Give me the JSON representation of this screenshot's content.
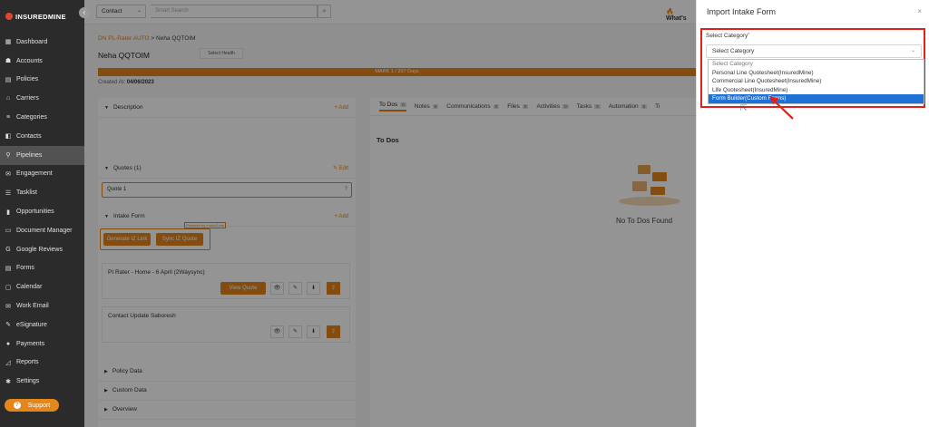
{
  "brand": {
    "name": "INSUREDMINE"
  },
  "sidebar": {
    "collapse_icon": "‹",
    "items": [
      {
        "label": "Dashboard",
        "icon": "▦"
      },
      {
        "label": "Accounts",
        "icon": "☗"
      },
      {
        "label": "Policies",
        "icon": "▤"
      },
      {
        "label": "Carriers",
        "icon": "⌂"
      },
      {
        "label": "Categories",
        "icon": "≡"
      },
      {
        "label": "Contacts",
        "icon": "◧"
      },
      {
        "label": "Pipelines",
        "icon": "⚲"
      },
      {
        "label": "Engagement",
        "icon": "✉"
      },
      {
        "label": "Tasklist",
        "icon": "☰"
      },
      {
        "label": "Opportunities",
        "icon": "▮"
      },
      {
        "label": "Document Manager",
        "icon": "▭"
      },
      {
        "label": "Google Reviews",
        "icon": "G"
      },
      {
        "label": "Forms",
        "icon": "▤"
      },
      {
        "label": "Calendar",
        "icon": "▢"
      },
      {
        "label": "Work Email",
        "icon": "✉"
      },
      {
        "label": "eSignature",
        "icon": "✎"
      },
      {
        "label": "Payments",
        "icon": "●"
      },
      {
        "label": "Reports",
        "icon": "◿"
      },
      {
        "label": "Settings",
        "icon": "✱"
      }
    ],
    "active_index": 6,
    "support_label": "Support"
  },
  "topbar": {
    "contact_select": "Contact",
    "search_placeholder": "Smart Search",
    "whats_new": "What's"
  },
  "record": {
    "breadcrumb_link": "DN PL-Rater AUTO",
    "breadcrumb_current": "> Neha QQTOIM",
    "name": "Neha QQTOIM",
    "health_label": "Select Health",
    "stage_label": "MARK 1 / 207 Days",
    "created_label": "Created At:",
    "created_value": "04/06/2023"
  },
  "left": {
    "description": {
      "title": "Description",
      "action": "+ Add"
    },
    "quotes": {
      "title": "Quotes (1)",
      "action": "✎ Edit",
      "item": "Quote 1",
      "item_icon": "?"
    },
    "intake": {
      "title": "Intake Form",
      "action": "+ Add",
      "generate_label": "Generate IZ Link",
      "sync_label": "Sync IZ Quote",
      "powered": "Powered by IntakeZone",
      "card1_title": "PI Rater - Home - 6 April (2Waysync)",
      "view_quote": "View Quote",
      "card2_title": "Contact Update Saboresh"
    },
    "policy_data": "Policy Data",
    "custom_data": "Custom Data",
    "overview": "Overview"
  },
  "tabs": [
    {
      "label": "To Dos",
      "count": "0"
    },
    {
      "label": "Notes",
      "count": "0"
    },
    {
      "label": "Communications",
      "count": "0"
    },
    {
      "label": "Files",
      "count": "0"
    },
    {
      "label": "Activities",
      "count": "0"
    },
    {
      "label": "Tasks",
      "count": "0"
    },
    {
      "label": "Automation",
      "count": "0"
    },
    {
      "label": "Ti",
      "count": ""
    }
  ],
  "todos": {
    "title": "To Dos",
    "empty": "No To Dos Found"
  },
  "modal": {
    "title": "Import Intake Form",
    "close": "×",
    "select_label": "Select Category",
    "required_mark": "*",
    "selected_value": "Select Category",
    "options": [
      "Select Category",
      "Personal Line Quotesheet(InsuredMine)",
      "Commercial Line Quotesheet(InsuredMine)",
      "Life Quotesheet(InsuredMine)",
      "Form Builder(Custom Forms)"
    ],
    "highlighted_index": 4
  },
  "colors": {
    "accent": "#e3861b",
    "sidebar": "#2b2b2b",
    "highlight": "#1e72d6",
    "annotation": "#e0201b"
  }
}
